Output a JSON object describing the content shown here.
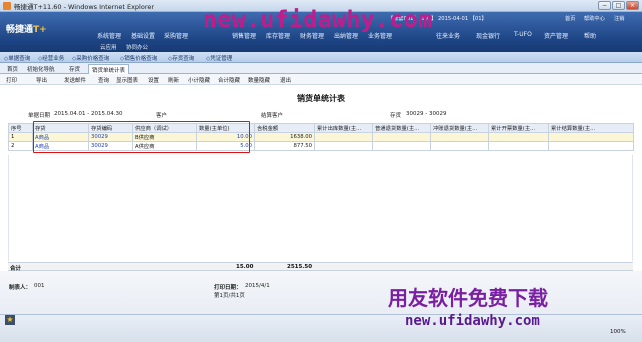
{
  "window": {
    "title": "畅捷通T+11.60 - Windows Internet Explorer",
    "min": "−",
    "max": "□",
    "close": "×"
  },
  "header": {
    "logo_prefix": "畅捷通",
    "logo_suffix": "T+",
    "nav": [
      "系统管理",
      "基础设置",
      "采购管理",
      "销售管理",
      "库存管理",
      "财务管理",
      "出纳管理",
      "业务管理",
      "往来业务",
      "现金银行",
      "T-UFO",
      "资产管理",
      "帮助"
    ],
    "sub_nav": [
      "云应用",
      "协同办公"
    ],
    "account_info": "【账套001】【001】 2015-04-01 【01】",
    "links": [
      "首页",
      "帮助中心",
      "注销"
    ]
  },
  "watermark_top": "new.ufidawhy.com",
  "quick_bar": [
    "◇单据查询",
    "◇经营业务",
    "◇采购价格查询",
    "◇销售价格查询",
    "◇存货查询",
    "◇凭证管理"
  ],
  "tabs": [
    "首页",
    "初始化导航",
    "存货",
    "销货单统计表"
  ],
  "toolbar": [
    "打印",
    "导出",
    "发送邮件",
    "查询",
    "显示图表",
    "设置",
    "刷新",
    "小计隐藏",
    "合计隐藏",
    "数量隐藏",
    "退出"
  ],
  "report": {
    "title": "销货单统计表",
    "date_label": "单据日期",
    "date_value": "2015.04.01 - 2015.04.30",
    "customer_label": "客户",
    "settle_label": "结算客户",
    "inventory_label": "存货",
    "inventory_value": "30029 - 30029"
  },
  "table": {
    "headers": [
      "序号",
      "存货",
      "存货编码",
      "供应商（调试）",
      "数量(主单位)",
      "含税金额",
      "累计出库数量(主...",
      "普通退货数量(主...",
      "冲账退货数量(主...",
      "累计开票数量(主...",
      "累计结算数量(主..."
    ],
    "rows": [
      [
        "1",
        "A商品",
        "30029",
        "B供应商",
        "10.00",
        "1638.00",
        "",
        "",
        "",
        "",
        ""
      ],
      [
        "2",
        "A商品",
        "30029",
        "A供应商",
        "5.00",
        "877.50",
        "",
        "",
        "",
        "",
        ""
      ]
    ]
  },
  "totals": {
    "label": "合计",
    "quantity": "15.00",
    "amount": "2515.50"
  },
  "footer": {
    "maker_label": "制表人：",
    "maker_value": "001",
    "print_date_label": "打印日期：",
    "print_date_value": "2015/4/1",
    "page_text": "第1页/共1页"
  },
  "watermark_bottom": {
    "line1": "用友软件免费下载",
    "line2": "new.ufidawhy.com"
  },
  "status": {
    "left": "★",
    "right": "100%"
  }
}
